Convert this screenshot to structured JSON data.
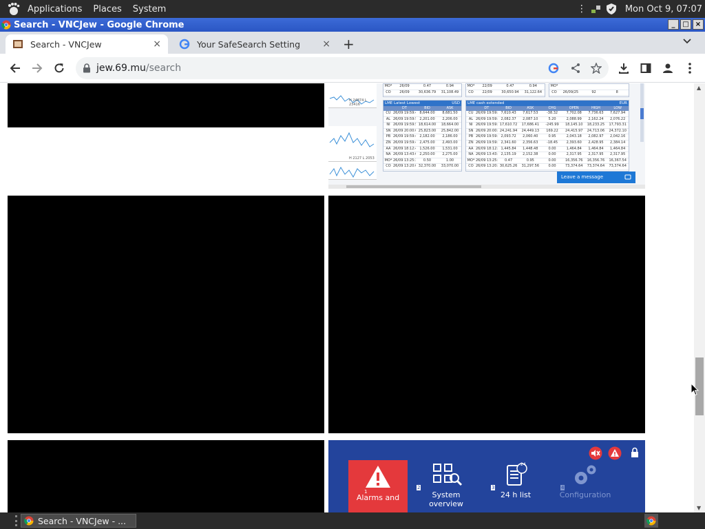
{
  "panel": {
    "menus": [
      "Applications",
      "Places",
      "System"
    ],
    "clock": "Mon Oct  9, 07:07"
  },
  "window": {
    "title": "Search - VNCJew - Google Chrome",
    "controls": [
      "_",
      "□",
      "×"
    ]
  },
  "tabs": [
    {
      "label": "Search - VNCJew",
      "close": "×",
      "active": true
    },
    {
      "label": "Your SafeSearch Setting",
      "close": "×",
      "active": false
    }
  ],
  "new_tab": "+",
  "address": {
    "host": "jew.69.mu",
    "path": "/search"
  },
  "lme": {
    "top_partial_rows": [
      [
        "MO*",
        "26/09",
        "0.47",
        "0.94"
      ],
      [
        "CO",
        "26/09",
        "30,636.79",
        "31,108.49"
      ]
    ],
    "top_partial_rows_b": [
      [
        "MO*",
        "22/09",
        "0.47",
        "0.94"
      ],
      [
        "CO",
        "22/09",
        "30,650.94",
        "31,122.64"
      ]
    ],
    "top_partial_rows_c": [
      [
        "MO*",
        "",
        ""
      ],
      [
        "CO",
        "26/09/25",
        "92",
        "8"
      ]
    ],
    "spark_labels": [
      "H 24874 L 23416",
      "H 2127 L 2053"
    ],
    "lowest": {
      "title": "LME Latest Lowest",
      "unit": "USD",
      "columns": [
        "",
        "DT",
        "BID",
        "ASK"
      ],
      "rows": [
        [
          "CU",
          "26/09 19:59:48",
          "8,644.00",
          "8,681.50"
        ],
        [
          "AL",
          "26/09 19:59:56",
          "2,201.00",
          "2,206.00"
        ],
        [
          "NI",
          "26/09 19:59:59",
          "18,614.00",
          "18,664.00"
        ],
        [
          "SN",
          "26/09 20:00:00",
          "25,823.00",
          "25,842.00"
        ],
        [
          "PB",
          "26/09 19:59:45",
          "2,182.00",
          "2,186.00"
        ],
        [
          "ZN",
          "26/09 19:59:41",
          "2,475.00",
          "2,493.00"
        ],
        [
          "AA",
          "26/09 18:12:41",
          "1,526.00",
          "1,531.00"
        ],
        [
          "NA",
          "26/09 13:43:07",
          "2,250.00",
          "2,275.00"
        ],
        [
          "MO*",
          "26/09 13:25:36",
          "0.50",
          "1.00"
        ],
        [
          "CO",
          "26/09 13:20:01",
          "32,370.00",
          "33,070.00"
        ]
      ]
    },
    "extended": {
      "title": "LME cash extended",
      "unit": "EUR",
      "columns": [
        "",
        "DT",
        "BID",
        "ASK",
        "CHG",
        "OPEN",
        "HIGH",
        "LOW"
      ],
      "rows": [
        [
          "CU",
          "26/09 19:59:48",
          "7,610.43",
          "7,617.53",
          "-38.32",
          "7,702.08",
          "7,736.63",
          "7,627.94"
        ],
        [
          "AL",
          "26/09 19:59:56",
          "2,082.37",
          "2,087.10",
          "5.20",
          "2,088.99",
          "2,162.24",
          "2,076.22"
        ],
        [
          "NI",
          "26/09 19:59:59",
          "17,610.72",
          "17,686.41",
          "-245.99",
          "18,145.10",
          "18,233.25",
          "17,793.31"
        ],
        [
          "SN",
          "26/09 20:00:00",
          "24,241.94",
          "24,449.13",
          "169.22",
          "24,415.97",
          "24,713.06",
          "24,372.10"
        ],
        [
          "PB",
          "26/09 19:59:45",
          "2,093.72",
          "2,060.40",
          "0.95",
          "2,043.18",
          "2,082.97",
          "2,042.16"
        ],
        [
          "ZN",
          "26/09 19:59:41",
          "2,341.60",
          "2,356.63",
          "-18.45",
          "2,393.60",
          "2,428.95",
          "2,384.14"
        ],
        [
          "AA",
          "26/09 18:12:41",
          "1,445.84",
          "1,448.48",
          "0.00",
          "1,464.84",
          "1,464.84",
          "1,464.84"
        ],
        [
          "NA",
          "26/09 13:43:07",
          "2,135.19",
          "2,152.38",
          "0.00",
          "2,317.95",
          "2,317.95",
          "2,317.95"
        ],
        [
          "MO*",
          "26/09 13:25:36",
          "0.47",
          "0.95",
          "0.00",
          "16,356.76",
          "16,356.76",
          "16,367.54"
        ],
        [
          "CO",
          "26/09 13:20:01",
          "30,625.26",
          "31,297.56",
          "0.00",
          "73,374.64",
          "73,374.64",
          "73,374.64"
        ]
      ]
    },
    "leave_message": "Leave a message"
  },
  "scada": {
    "tiles": [
      {
        "label": "Alarms and"
      },
      {
        "label": "System overview"
      },
      {
        "label": "24 h list"
      },
      {
        "label": "Configuration"
      }
    ],
    "tile_numbers": [
      "1",
      "2",
      "3",
      "4"
    ],
    "twentyfour": "24"
  },
  "taskbar": {
    "item_label": "Search - VNCJew - ..."
  },
  "colors": {
    "panel": "#2b2b2b",
    "titlebar": "#3c6bd8",
    "scada_bg": "#23449c",
    "alarm_red": "#e4393c"
  }
}
